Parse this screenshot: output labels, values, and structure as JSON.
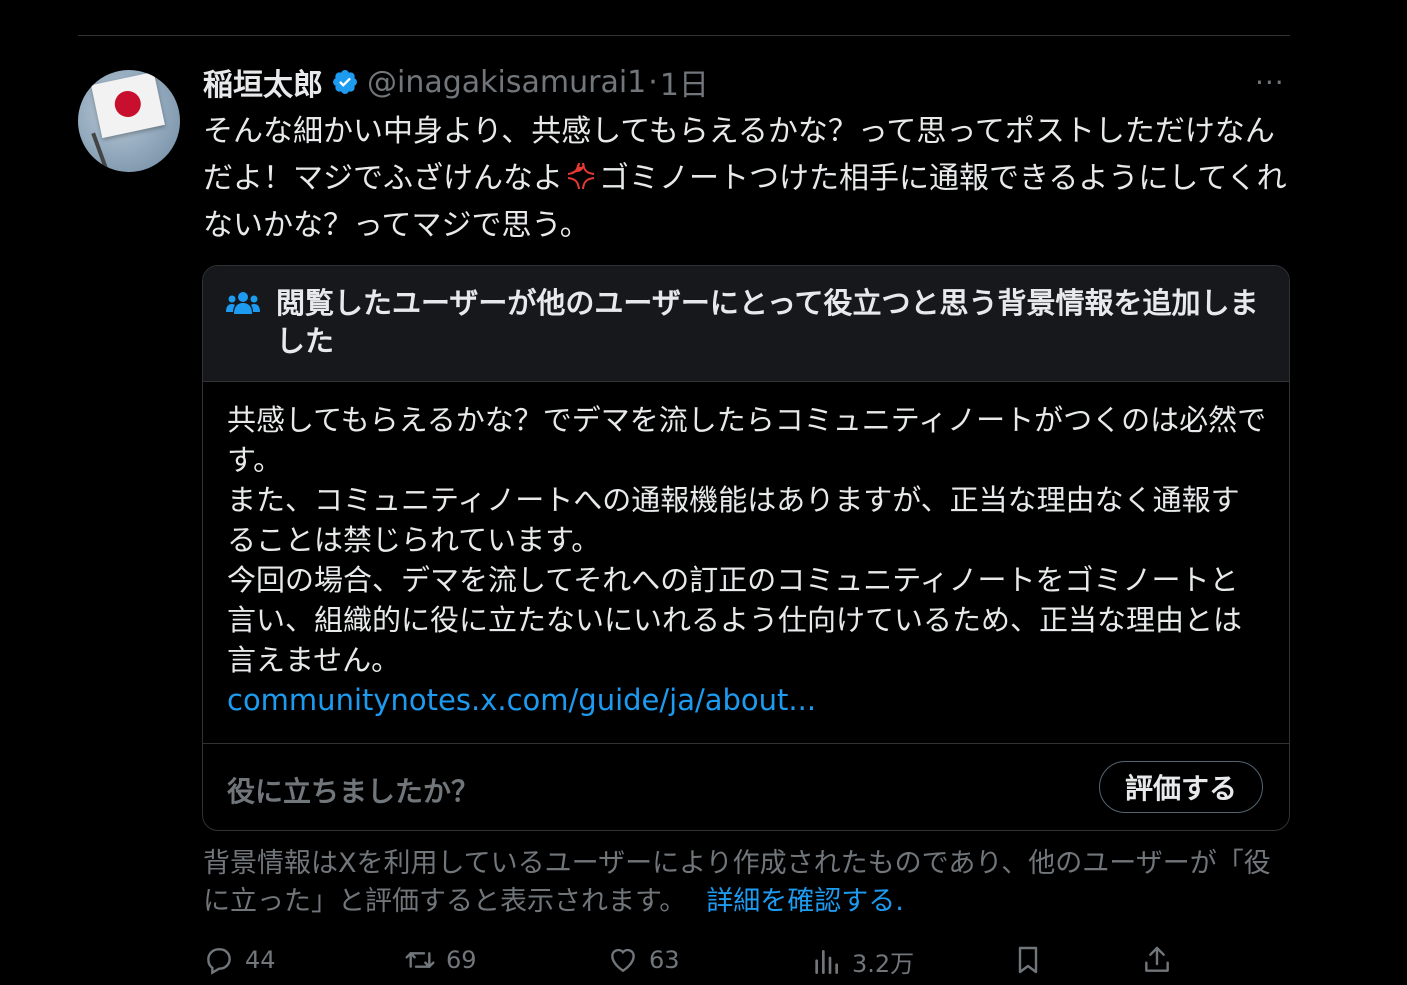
{
  "tweet": {
    "author_name": "稲垣太郎",
    "handle": "@inagakisamurai1",
    "separator": "·",
    "time": "1日",
    "more_label": "···",
    "text_part1": "そんな細かい中身より、共感してもらえるかな？って思ってポストしただけなんだよ！マジでふざけんなよ",
    "text_part2": "ゴミノートつけた相手に通報できるようにしてくれないかな？ってマジで思う。"
  },
  "note": {
    "header_title": "閲覧したユーザーが他のユーザーにとって役立つと思う背景情報を追加しました",
    "lines": [
      "共感してもらえるかな？でデマを流したらコミュニティノートがつくのは必然です。",
      "また、コミュニティノートへの通報機能はありますが、正当な理由なく通報することは禁じられています。",
      "今回の場合、デマを流してそれへの訂正のコミュニティノートをゴミノートと言い、組織的に役に立たないにいれるよう仕向けているため、正当な理由とは言えません。"
    ],
    "link": "communitynotes.x.com/guide/ja/about...",
    "helpful_question": "役に立ちましたか？",
    "rate_button": "評価する"
  },
  "disclaimer": {
    "text": "背景情報はXを利用しているユーザーにより作成されたものであり、他のユーザーが「役に立った」と評価すると表示されます。",
    "link": "詳細を確認する."
  },
  "actions": {
    "replies": "44",
    "reposts": "69",
    "likes": "63",
    "views": "3.2万"
  },
  "colors": {
    "background": "#000000",
    "text": "#e7e9ea",
    "muted": "#71767b",
    "link": "#1d9bf0",
    "border": "#2f3336"
  }
}
